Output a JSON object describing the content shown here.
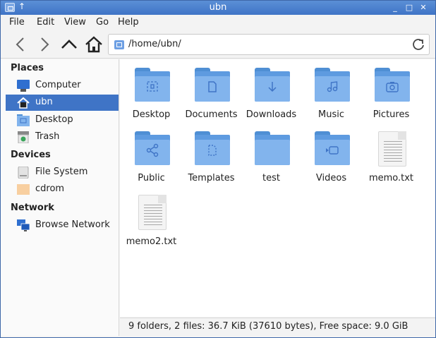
{
  "window": {
    "title": "ubn"
  },
  "menu": [
    "File",
    "Edit",
    "View",
    "Go",
    "Help"
  ],
  "toolbar": {
    "path": "/home/ubn/"
  },
  "sidebar": {
    "sections": [
      {
        "header": "Places",
        "items": [
          {
            "label": "Computer",
            "icon": "computer-icon"
          },
          {
            "label": "ubn",
            "icon": "home-icon",
            "selected": true
          },
          {
            "label": "Desktop",
            "icon": "desktop-folder-icon"
          },
          {
            "label": "Trash",
            "icon": "trash-icon"
          }
        ]
      },
      {
        "header": "Devices",
        "items": [
          {
            "label": "File System",
            "icon": "drive-icon"
          },
          {
            "label": "cdrom",
            "icon": "cdrom-icon"
          }
        ]
      },
      {
        "header": "Network",
        "items": [
          {
            "label": "Browse Network",
            "icon": "network-icon"
          }
        ]
      }
    ]
  },
  "files": [
    {
      "name": "Desktop",
      "type": "folder",
      "icon": "desktop-folder-icon"
    },
    {
      "name": "Documents",
      "type": "folder",
      "icon": "documents-folder-icon"
    },
    {
      "name": "Downloads",
      "type": "folder",
      "icon": "downloads-folder-icon"
    },
    {
      "name": "Music",
      "type": "folder",
      "icon": "music-folder-icon"
    },
    {
      "name": "Pictures",
      "type": "folder",
      "icon": "pictures-folder-icon"
    },
    {
      "name": "Public",
      "type": "folder",
      "icon": "public-folder-icon"
    },
    {
      "name": "Templates",
      "type": "folder",
      "icon": "templates-folder-icon"
    },
    {
      "name": "test",
      "type": "folder",
      "icon": "folder-icon"
    },
    {
      "name": "Videos",
      "type": "folder",
      "icon": "videos-folder-icon"
    },
    {
      "name": "memo.txt",
      "type": "file",
      "icon": "text-file-icon"
    },
    {
      "name": "memo2.txt",
      "type": "file",
      "icon": "text-file-icon"
    }
  ],
  "status": {
    "text": "9 folders, 2 files: 36.7 KiB (37610 bytes), Free space: 9.0 GiB"
  },
  "colors": {
    "accent": "#3f74c6",
    "folder": "#5e9be0",
    "folder_light": "#82b4ed"
  }
}
